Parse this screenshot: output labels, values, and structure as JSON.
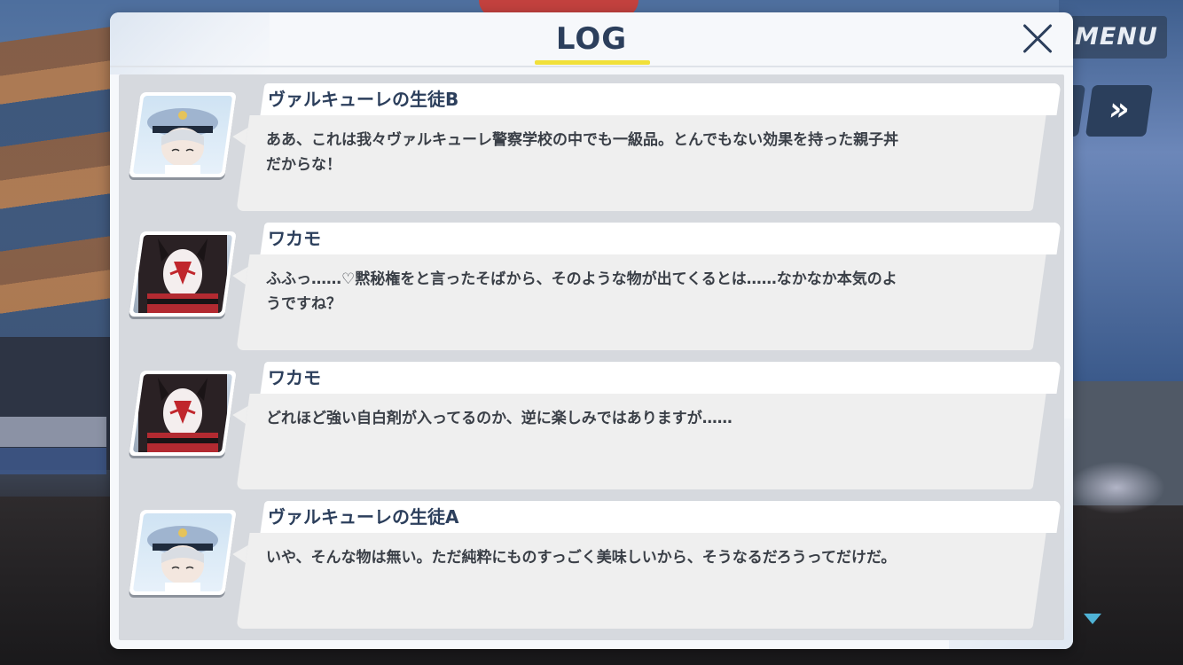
{
  "hud": {
    "menu_label": "MENU",
    "skip_label": "»"
  },
  "log_panel": {
    "title": "LOG",
    "close_icon": "close-icon",
    "accent_color": "#f1e03a",
    "entries": [
      {
        "speaker": "ヴァルキューレの生徒B",
        "portrait": "police-student-portrait",
        "text": "ああ、これは我々ヴァルキューレ警察学校の中でも一級品。とんでもない効果を持った親子丼\nだからな！"
      },
      {
        "speaker": "ワカモ",
        "portrait": "fox-mask-portrait",
        "text": "ふふっ……♡黙秘権をと言ったそばから、そのような物が出てくるとは……なかなか本気のよ\nうですね？"
      },
      {
        "speaker": "ワカモ",
        "portrait": "fox-mask-portrait",
        "text": "どれほど強い自白剤が入ってるのか、逆に楽しみではありますが……"
      },
      {
        "speaker": "ヴァルキューレの生徒A",
        "portrait": "police-student-portrait",
        "text": "いや、そんな物は無い。ただ純粋にものすっごく美味しいから、そうなるだろうってだけだ。"
      }
    ]
  }
}
